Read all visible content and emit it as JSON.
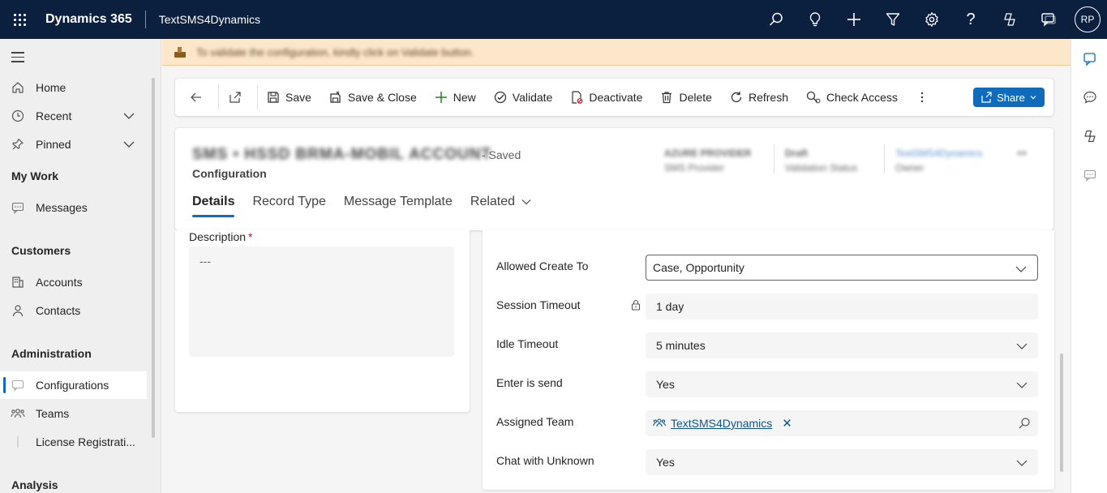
{
  "topbar": {
    "brand": "Dynamics 365",
    "app_name": "TextSMS4Dynamics",
    "user_initials": "RP",
    "icons": [
      "search-icon",
      "lightbulb-icon",
      "plus-icon",
      "filter-icon",
      "gear-icon",
      "help-icon",
      "copilot-icon",
      "chat-icon"
    ]
  },
  "nav": {
    "items": [
      {
        "label": "Home",
        "icon": "home-icon"
      },
      {
        "label": "Recent",
        "icon": "clock-icon"
      },
      {
        "label": "Pinned",
        "icon": "pin-icon"
      }
    ],
    "sections": [
      {
        "header": "My Work",
        "items": [
          {
            "label": "Messages",
            "icon": "message-icon"
          }
        ]
      },
      {
        "header": "Customers",
        "items": [
          {
            "label": "Accounts",
            "icon": "building-icon"
          },
          {
            "label": "Contacts",
            "icon": "person-icon"
          }
        ]
      },
      {
        "header": "Administration",
        "items": [
          {
            "label": "Configurations",
            "icon": "config-icon"
          },
          {
            "label": "Teams",
            "icon": "team-icon"
          },
          {
            "label": "License Registrati...",
            "icon": "license-icon"
          }
        ]
      },
      {
        "header": "Analysis",
        "items": []
      }
    ]
  },
  "notification": {
    "text": "To validate the configuration, kindly click on Validate button."
  },
  "commands": {
    "save": "Save",
    "save_close": "Save & Close",
    "new": "New",
    "validate": "Validate",
    "deactivate": "Deactivate",
    "delete": "Delete",
    "refresh": "Refresh",
    "check_access": "Check Access",
    "share": "Share"
  },
  "record": {
    "title": "SMS • HSSD BRMA-MOBIL ACCOUNT",
    "saved_status": "- Saved",
    "entity": "Configuration",
    "header_fields": [
      {
        "value": "AZURE PROVIDER",
        "label": "SMS Provider"
      },
      {
        "value": "Draft",
        "label": "Validation Status"
      },
      {
        "value": "TextSMS4Dynamics",
        "label": "Owner"
      }
    ]
  },
  "tabs": [
    {
      "label": "Details"
    },
    {
      "label": "Record Type"
    },
    {
      "label": "Message Template"
    },
    {
      "label": "Related"
    }
  ],
  "description": {
    "label": "Description",
    "required_mark": "*",
    "value": "---"
  },
  "fields": {
    "allowed_create_to": {
      "label": "Allowed Create To",
      "value": "Case, Opportunity"
    },
    "session_timeout": {
      "label": "Session Timeout",
      "value": "1 day"
    },
    "idle_timeout": {
      "label": "Idle Timeout",
      "value": "5 minutes"
    },
    "enter_is_send": {
      "label": "Enter is send",
      "value": "Yes"
    },
    "assigned_team": {
      "label": "Assigned Team",
      "value": "TextSMS4Dynamics"
    },
    "chat_with_unknown": {
      "label": "Chat with Unknown",
      "value": "Yes"
    }
  }
}
